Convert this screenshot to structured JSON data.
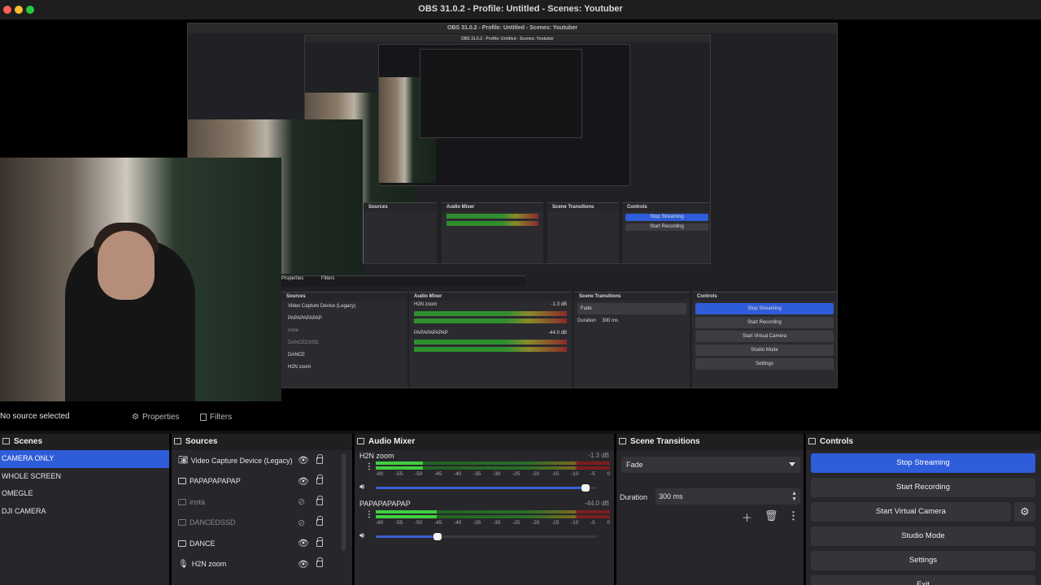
{
  "window": {
    "title": "OBS 31.0.2 - Profile: Untitled - Scenes: Youtuber"
  },
  "preview": {
    "nested_title": "OBS 31.0.2 - Profile: Untitled - Scenes: Youtuber",
    "nested_sources": [
      "Video Capture Device (Legacy)",
      "PAPAPAPAPAP",
      "insta",
      "DANCEDSSD",
      "DANCE",
      "H2N zoom"
    ],
    "nested_mixer": {
      "ch1": "H2N zoom",
      "ch1_db": "-1.3 dB",
      "ch2": "PAPAPAPAPAP",
      "ch2_db": "-44.0 dB"
    },
    "nested_transition": {
      "value": "Fade",
      "duration_label": "Duration",
      "duration": "300 ms"
    },
    "nested_controls": [
      "Stop Streaming",
      "Start Recording",
      "Start Virtual Camera",
      "Studio Mode",
      "Settings"
    ],
    "nested_headers": {
      "sources": "Sources",
      "mixer": "Audio Mixer",
      "transitions": "Scene Transitions",
      "controls": "Controls",
      "properties": "Properties",
      "filters": "Filters"
    }
  },
  "status": {
    "no_source": "No source selected",
    "properties": "Properties",
    "filters": "Filters"
  },
  "scenes": {
    "title": "Scenes",
    "items": [
      "CAMERA ONLY",
      "WHOLE SCREEN",
      "OMEGLE",
      "DJI CAMERA"
    ],
    "selected_index": 0
  },
  "sources": {
    "title": "Sources",
    "items": [
      {
        "label": "Video Capture Device (Legacy)",
        "icon": "camera-icon",
        "visible": true
      },
      {
        "label": "PAPAPAPAPAP",
        "icon": "window-icon",
        "visible": true
      },
      {
        "label": "insta",
        "icon": "window-icon",
        "visible": false
      },
      {
        "label": "DANCEDSSD",
        "icon": "window-icon",
        "visible": false
      },
      {
        "label": "DANCE",
        "icon": "image-icon",
        "visible": true
      },
      {
        "label": "H2N zoom",
        "icon": "microphone-icon",
        "visible": true
      }
    ]
  },
  "mixer": {
    "title": "Audio Mixer",
    "ticks": [
      "-60",
      "-55",
      "-50",
      "-45",
      "-40",
      "-35",
      "-30",
      "-25",
      "-20",
      "-15",
      "-10",
      "-5",
      "0"
    ],
    "channels": [
      {
        "name": "H2N zoom",
        "db": "-1.3 dB",
        "level": 0.2,
        "volume": 0.95
      },
      {
        "name": "PAPAPAPAPAP",
        "db": "-44.0 dB",
        "level": 0.26,
        "volume": 0.28
      }
    ]
  },
  "transitions": {
    "title": "Scene Transitions",
    "selected": "Fade",
    "duration_label": "Duration",
    "duration_value": "300 ms"
  },
  "controls": {
    "title": "Controls",
    "stop_streaming": "Stop Streaming",
    "start_recording": "Start Recording",
    "start_virtual_camera": "Start Virtual Camera",
    "studio_mode": "Studio Mode",
    "settings": "Settings",
    "exit": "Exit"
  },
  "colors": {
    "accent": "#2f5cd8",
    "panel": "#27272b",
    "meter_green": "#3fd03f"
  }
}
